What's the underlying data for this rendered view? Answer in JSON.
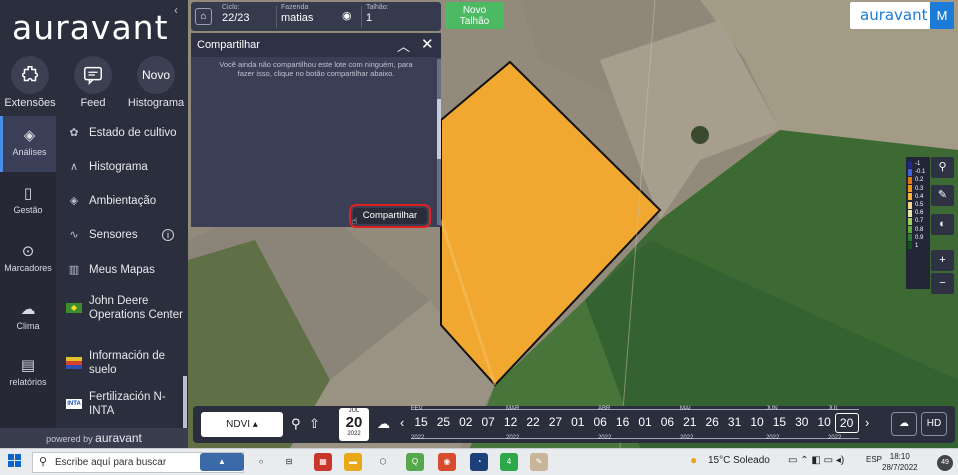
{
  "brand": {
    "logo": "auravant",
    "user_initial": "M",
    "powered_prefix": "powered by",
    "powered_brand": "auravant",
    "accent": "#1c7bd6"
  },
  "quick_actions": [
    {
      "label": "Extensões",
      "icon": "puzzle-icon"
    },
    {
      "label": "Feed",
      "icon": "feed-icon"
    },
    {
      "label": "Histograma",
      "icon_text": "Novo"
    }
  ],
  "left_nav": [
    {
      "label": "Análises",
      "icon": "layers-icon",
      "active": true
    },
    {
      "label": "Gestão",
      "icon": "book-icon"
    },
    {
      "label": "Marcadores",
      "icon": "pin-icon"
    },
    {
      "label": "Clima",
      "icon": "cloud-icon"
    },
    {
      "label": "relatórios",
      "icon": "clipboard-icon"
    }
  ],
  "menu": [
    {
      "label": "Estado de cultivo",
      "icon": "plant-icon"
    },
    {
      "label": "Histograma",
      "icon": "histogram-icon"
    },
    {
      "label": "Ambientação",
      "icon": "layers-icon"
    },
    {
      "label": "Sensores",
      "icon": "pulse-icon",
      "info": "i"
    },
    {
      "label": "Meus Mapas",
      "icon": "map-icon"
    },
    {
      "label": "John Deere Operations Center",
      "icon": "john-deere-icon"
    },
    {
      "label": "Información de suelo",
      "icon": "soil-icon"
    },
    {
      "label": "Fertilización N-INTA",
      "icon": "inta-icon"
    }
  ],
  "topbar": {
    "ciclo_caption": "Ciclo:",
    "ciclo_value": "22/23",
    "fazenda_caption": "Fazenda",
    "fazenda_value": "matias",
    "talhao_caption": "Talhão:",
    "talhao_value": "1",
    "new_plot_label": "Novo\nTalhão",
    "new_plot_color": "#4cba62"
  },
  "share_panel": {
    "title": "Compartilhar",
    "message": "Você ainda não compartilhou este lote com ninguém, para fazer isso, clique no botão compartilhar abaixo.",
    "button": "Compartilhar",
    "highlight_color": "#e01f1f"
  },
  "legend": [
    {
      "label": "-1",
      "color": "#1f2a8a"
    },
    {
      "label": "-0.1",
      "color": "#3f64d8"
    },
    {
      "label": "0.2",
      "color": "#e07a10"
    },
    {
      "label": "0.3",
      "color": "#ef9a18"
    },
    {
      "label": "0.4",
      "color": "#f6b63a"
    },
    {
      "label": "0.5",
      "color": "#f4d98a"
    },
    {
      "label": "0.6",
      "color": "#e6e6a8"
    },
    {
      "label": "0.7",
      "color": "#9fcf5a"
    },
    {
      "label": "0.8",
      "color": "#5ea83a"
    },
    {
      "label": "0.9",
      "color": "#2f7f2a"
    },
    {
      "label": "1",
      "color": "#12561c"
    }
  ],
  "map_tools": {
    "zoom_in": "+",
    "zoom_out": "−"
  },
  "timeline": {
    "layer": "NDVI ▴",
    "current_month": "JUL",
    "current_day": "20",
    "current_year": "2022",
    "months": [
      "FEV",
      "MAR",
      "ABR",
      "MAI",
      "JUN",
      "JUL"
    ],
    "years": [
      "2022",
      "2022",
      "2022",
      "2022",
      "2022",
      "2022"
    ],
    "days": [
      "15",
      "25",
      "02",
      "07",
      "12",
      "22",
      "27",
      "01",
      "06",
      "16",
      "01",
      "06",
      "21",
      "26",
      "31",
      "10",
      "15",
      "30",
      "10",
      "20"
    ],
    "selected_day": "20",
    "hd_label": "HD"
  },
  "taskbar": {
    "search_placeholder": "Escribe aquí para buscar",
    "weather": "15°C  Soleado",
    "language": "ESP",
    "time": "18:10",
    "date": "28/7/2022",
    "notifications": "49",
    "mail_badge": "4"
  }
}
